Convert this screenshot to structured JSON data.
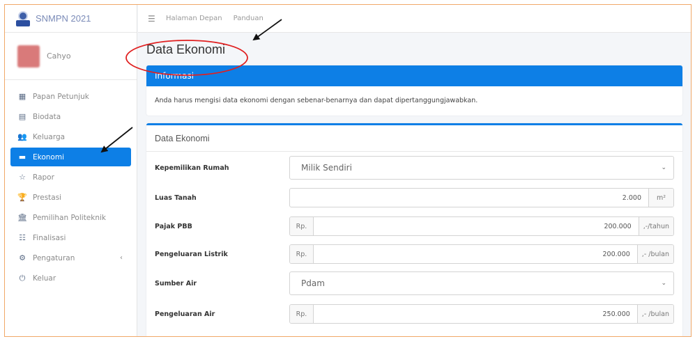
{
  "brand": {
    "title": "SNMPN 2021"
  },
  "user": {
    "name": "Cahyo"
  },
  "sidebar": {
    "items": [
      {
        "label": "Papan Petunjuk",
        "icon": "dashboard-icon"
      },
      {
        "label": "Biodata",
        "icon": "id-card-icon"
      },
      {
        "label": "Keluarga",
        "icon": "users-icon"
      },
      {
        "label": "Ekonomi",
        "icon": "wallet-icon",
        "active": true
      },
      {
        "label": "Rapor",
        "icon": "star-icon"
      },
      {
        "label": "Prestasi",
        "icon": "trophy-icon"
      },
      {
        "label": "Pemilihan Politeknik",
        "icon": "institution-icon"
      },
      {
        "label": "Finalisasi",
        "icon": "checklist-icon"
      },
      {
        "label": "Pengaturan",
        "icon": "gear-icon",
        "chevron": "‹"
      },
      {
        "label": "Keluar",
        "icon": "power-icon"
      }
    ]
  },
  "topbar": {
    "links": [
      "Halaman Depan",
      "Panduan"
    ]
  },
  "page": {
    "title": "Data Ekonomi"
  },
  "info": {
    "title": "Informasi",
    "text": "Anda harus mengisi data ekonomi dengan sebenar-benarnya dan dapat dipertanggungjawabkan."
  },
  "form": {
    "title": "Data Ekonomi",
    "kepemilikan": {
      "label": "Kepemilikan Rumah",
      "value": "Milik Sendiri"
    },
    "luas": {
      "label": "Luas Tanah",
      "value": "2.000",
      "suffix": "m²"
    },
    "pbb": {
      "label": "Pajak PBB",
      "prefix": "Rp.",
      "value": "200.000",
      "suffix": ",-/tahun"
    },
    "listrik": {
      "label": "Pengeluaran Listrik",
      "prefix": "Rp.",
      "value": "200.000",
      "suffix": ",- /bulan"
    },
    "sumber_air": {
      "label": "Sumber Air",
      "value": "Pdam"
    },
    "air": {
      "label": "Pengeluaran Air",
      "prefix": "Rp.",
      "value": "250.000",
      "suffix": ",- /bulan"
    }
  },
  "colors": {
    "accent": "#0d7fe6",
    "annotation": "#e02020"
  }
}
